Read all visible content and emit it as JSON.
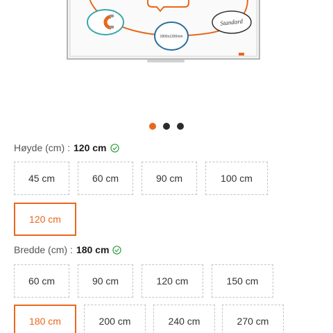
{
  "height_option": {
    "label": "Høyde (cm)",
    "separator": ":",
    "selected_value": "120 cm",
    "options": [
      "45 cm",
      "60 cm",
      "90 cm",
      "100 cm",
      "120 cm"
    ],
    "selected_index": 4
  },
  "width_option": {
    "label": "Bredde (cm)",
    "separator": ":",
    "selected_value": "180 cm",
    "options": [
      "60 cm",
      "90 cm",
      "120 cm",
      "150 cm",
      "180 cm",
      "200 cm",
      "240 cm",
      "270 cm"
    ],
    "selected_index": 4
  },
  "carousel": {
    "dot_count": 3,
    "active_index": 0
  },
  "whiteboard_image": {
    "note_standard": "Standard",
    "note_size": "1800x1200mm"
  },
  "colors": {
    "accent": "#e8671c",
    "check": "#2e9e3c",
    "text": "#555555"
  }
}
